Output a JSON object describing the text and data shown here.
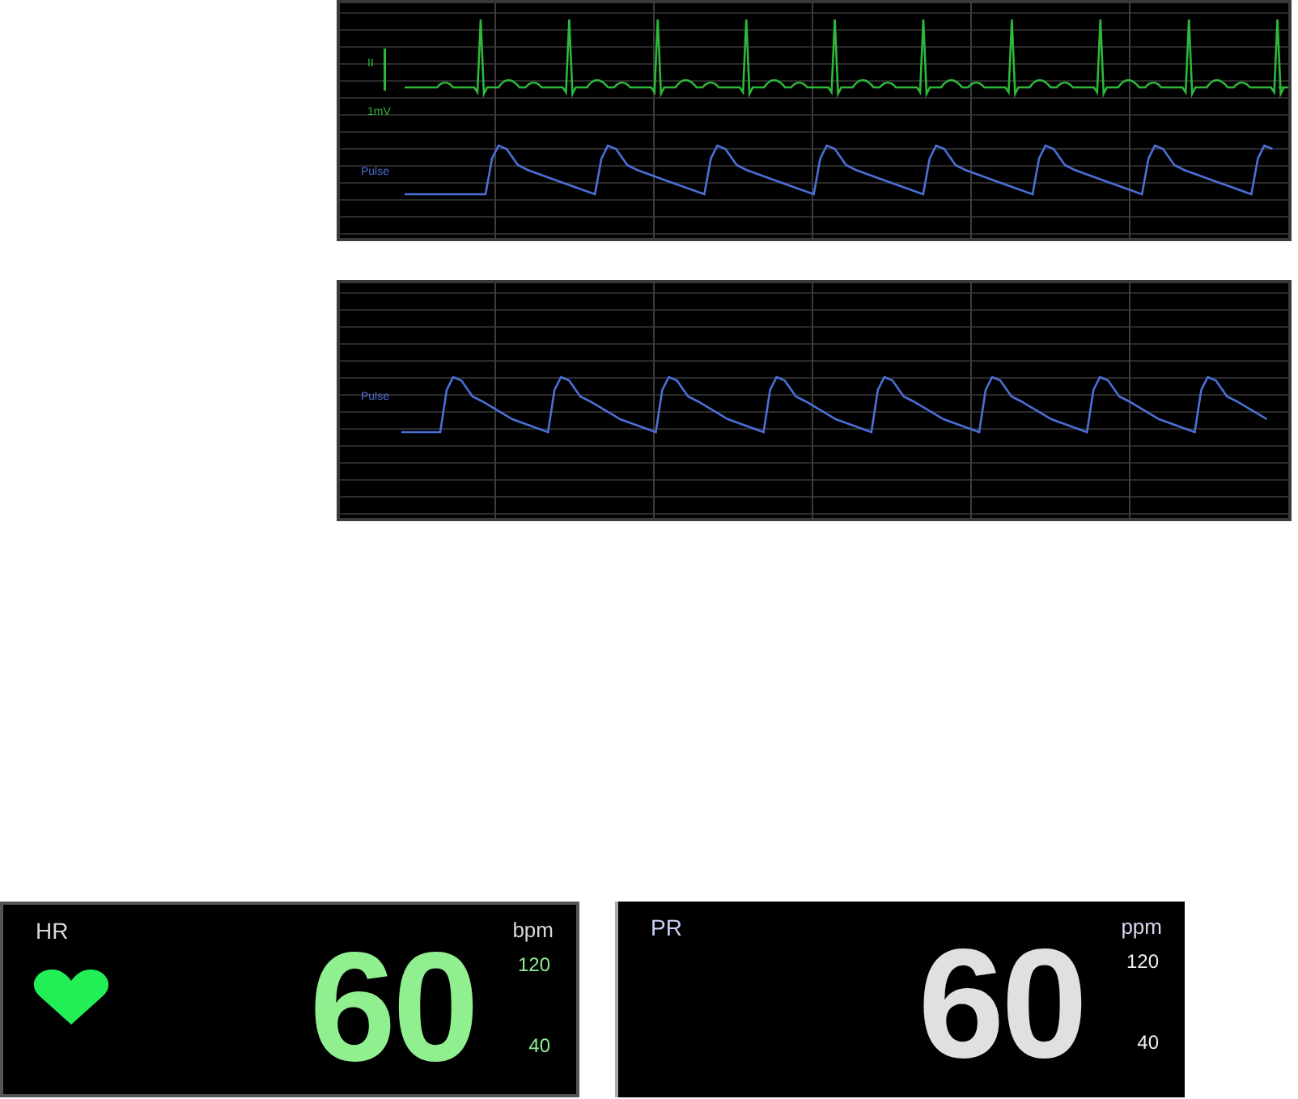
{
  "waveform_panels": [
    {
      "traces": [
        {
          "kind": "ecg",
          "label": "II",
          "scale": "1mV",
          "color": "#2eb83a"
        },
        {
          "kind": "pleth",
          "label": "Pulse",
          "color": "#4c6fd6"
        }
      ]
    },
    {
      "traces": [
        {
          "kind": "pleth",
          "label": "Pulse",
          "color": "#4c6fd6"
        }
      ]
    }
  ],
  "parameter_tiles": [
    {
      "kind": "hr",
      "label": "HR",
      "unit": "bpm",
      "value": "60",
      "high_limit": "120",
      "low_limit": "40",
      "color": "#90f090"
    },
    {
      "kind": "pr",
      "label": "PR",
      "unit": "ppm",
      "value": "60",
      "high_limit": "120",
      "low_limit": "40",
      "color": "#e0e0e0"
    }
  ]
}
